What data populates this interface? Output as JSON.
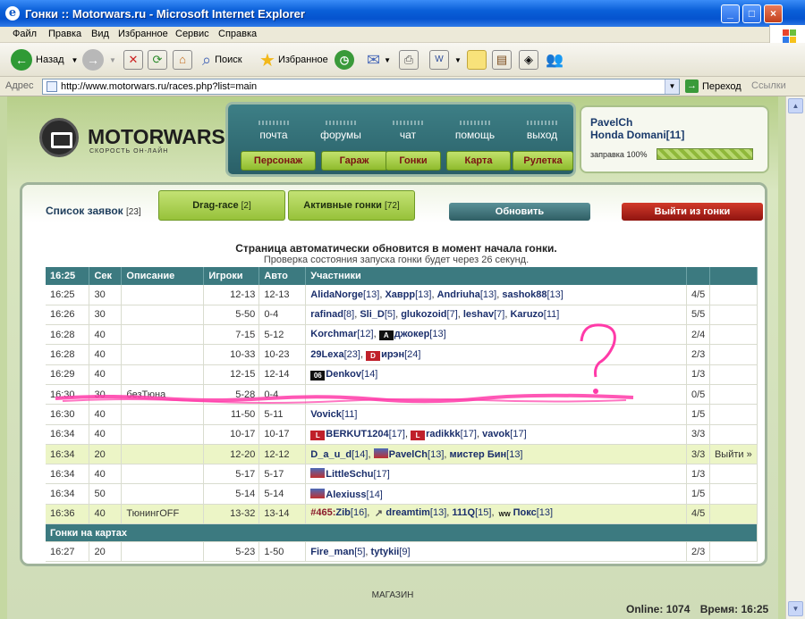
{
  "window": {
    "title": "Гонки :: Motorwars.ru - Microsoft Internet Explorer",
    "min": "_",
    "max": "□",
    "close": "×"
  },
  "menu": [
    "Файл",
    "Правка",
    "Вид",
    "Избранное",
    "Сервис",
    "Справка"
  ],
  "toolbar": {
    "back": "Назад",
    "search": "Поиск",
    "favorites": "Избранное"
  },
  "address": {
    "label": "Адрес",
    "url": "http://www.motorwars.ru/races.php?list=main",
    "go": "Переход",
    "links": "Ссылки"
  },
  "site": {
    "logo": "MOTORWARS.RU",
    "tagline": "СКОРОСТЬ ОН-ЛАЙН",
    "nav_top": [
      "почта",
      "форумы",
      "чат",
      "помощь",
      "выход"
    ],
    "nav_buttons": [
      "Персонаж",
      "Гараж",
      "Гонки",
      "Карта",
      "Рулетка"
    ],
    "user": {
      "name": "PavelCh",
      "car": "Honda Domani[11]",
      "fuel_label": "заправка 100%",
      "fuel_percent": 100
    }
  },
  "races": {
    "tab_list": "Список заявок",
    "tab_list_count": "[23]",
    "tab_drag": "Drag-race",
    "tab_drag_count": "[2]",
    "tab_active": "Активные гонки",
    "tab_active_count": "[72]",
    "refresh": "Обновить",
    "exit": "Выйти из гонки",
    "notice1": "Страница автоматически обновится в момент начала гонки.",
    "notice2": "Проверка состояния запуска гонки будет через 26 секунд.",
    "headers": [
      "16:25",
      "Сек",
      "Описание",
      "Игроки",
      "Авто",
      "Участники",
      "",
      ""
    ],
    "section_maps": "Гонки на картах",
    "rows": [
      {
        "time": "16:25",
        "sec": "30",
        "desc": "",
        "players": "12-13",
        "auto": "12-13",
        "count": "4/5",
        "action": "",
        "p": [
          {
            "n": "AlidaNorge",
            "l": "[13]"
          },
          {
            "n": "Хаврр",
            "l": "[13]"
          },
          {
            "n": "Andriuha",
            "l": "[13]"
          },
          {
            "n": "sashok88",
            "l": "[13]"
          }
        ]
      },
      {
        "time": "16:26",
        "sec": "30",
        "desc": "",
        "players": "5-50",
        "auto": "0-4",
        "count": "5/5",
        "action": "",
        "p": [
          {
            "n": "rafinad",
            "l": "[8]"
          },
          {
            "n": "Sli_D",
            "l": "[5]"
          },
          {
            "n": "glukozoid",
            "l": "[7]"
          },
          {
            "n": "leshav",
            "l": "[7]"
          },
          {
            "n": "Karuzo",
            "l": "[11]"
          }
        ]
      },
      {
        "time": "16:28",
        "sec": "40",
        "desc": "",
        "players": "7-15",
        "auto": "5-12",
        "count": "2/4",
        "action": "",
        "p": [
          {
            "n": "Korchmar",
            "l": "[12]"
          },
          {
            "n": "джокер",
            "l": "[13]",
            "b": "b-dark",
            "bt": "A"
          }
        ]
      },
      {
        "time": "16:28",
        "sec": "40",
        "desc": "",
        "players": "10-33",
        "auto": "10-23",
        "count": "2/3",
        "action": "",
        "p": [
          {
            "n": "29Lexa",
            "l": "[23]"
          },
          {
            "n": "ирэн",
            "l": "[24]",
            "b": "b-red",
            "bt": "D"
          }
        ]
      },
      {
        "time": "16:29",
        "sec": "40",
        "desc": "",
        "players": "12-15",
        "auto": "12-14",
        "count": "1/3",
        "action": "",
        "p": [
          {
            "n": "Denkov",
            "l": "[14]",
            "b": "b-dark",
            "bt": "06"
          }
        ]
      },
      {
        "time": "16:30",
        "sec": "30",
        "desc": "безТюна",
        "players": "5-28",
        "auto": "0-4",
        "count": "0/5",
        "action": "",
        "p": []
      },
      {
        "time": "16:30",
        "sec": "40",
        "desc": "",
        "players": "11-50",
        "auto": "5-11",
        "count": "1/5",
        "action": "",
        "p": [
          {
            "n": "Vovick",
            "l": "[11]"
          }
        ]
      },
      {
        "time": "16:34",
        "sec": "40",
        "desc": "",
        "players": "10-17",
        "auto": "10-17",
        "count": "3/3",
        "action": "",
        "p": [
          {
            "n": "BERKUT1204",
            "l": "[17]",
            "b": "b-red",
            "bt": "L"
          },
          {
            "n": "radikkk",
            "l": "[17]",
            "b": "b-red",
            "bt": "L"
          },
          {
            "n": "vavok",
            "l": "[17]"
          }
        ]
      },
      {
        "time": "16:34",
        "sec": "20",
        "desc": "",
        "players": "12-20",
        "auto": "12-12",
        "count": "3/3",
        "action": "Выйти »",
        "hl": true,
        "p": [
          {
            "n": "D_a_u_d",
            "l": "[14]"
          },
          {
            "n": "PavelCh",
            "l": "[13]",
            "b": "b-car",
            "bt": ""
          },
          {
            "n": "мистер Бин",
            "l": "[13]"
          }
        ]
      },
      {
        "time": "16:34",
        "sec": "40",
        "desc": "",
        "players": "5-17",
        "auto": "5-17",
        "count": "1/3",
        "action": "",
        "p": [
          {
            "n": "LittleSchu",
            "l": "[17]",
            "b": "b-car",
            "bt": ""
          }
        ]
      },
      {
        "time": "16:34",
        "sec": "50",
        "desc": "",
        "players": "5-14",
        "auto": "5-14",
        "count": "1/5",
        "action": "",
        "p": [
          {
            "n": "Alexiuss",
            "l": "[14]",
            "b": "b-car",
            "bt": ""
          }
        ]
      },
      {
        "time": "16:36",
        "sec": "40",
        "desc": "ТюнингOFF",
        "players": "13-32",
        "auto": "13-14",
        "count": "4/5",
        "action": "",
        "hl": true,
        "p": [
          {
            "n": "Zib",
            "l": "[16]",
            "clan": "#465:"
          },
          {
            "n": "dreamtim",
            "l": "[13]",
            "b": "b-sword",
            "bt": "↗"
          },
          {
            "n": "111Q",
            "l": "[15]"
          },
          {
            "n": "Покс",
            "l": "[13]",
            "b": "b-ww",
            "bt": "WW"
          }
        ]
      }
    ],
    "map_rows": [
      {
        "time": "16:27",
        "sec": "20",
        "desc": "",
        "players": "5-23",
        "auto": "1-50",
        "count": "2/3",
        "action": "",
        "p": [
          {
            "n": "Fire_man",
            "l": "[5]"
          },
          {
            "n": "tytykii",
            "l": "[9]"
          }
        ]
      }
    ]
  },
  "footer": {
    "shop": "МАГАЗИН",
    "online_label": "Online:",
    "online": "1074",
    "time_label": "Время:",
    "time": "16:25"
  },
  "annotation": {
    "question": "?"
  }
}
